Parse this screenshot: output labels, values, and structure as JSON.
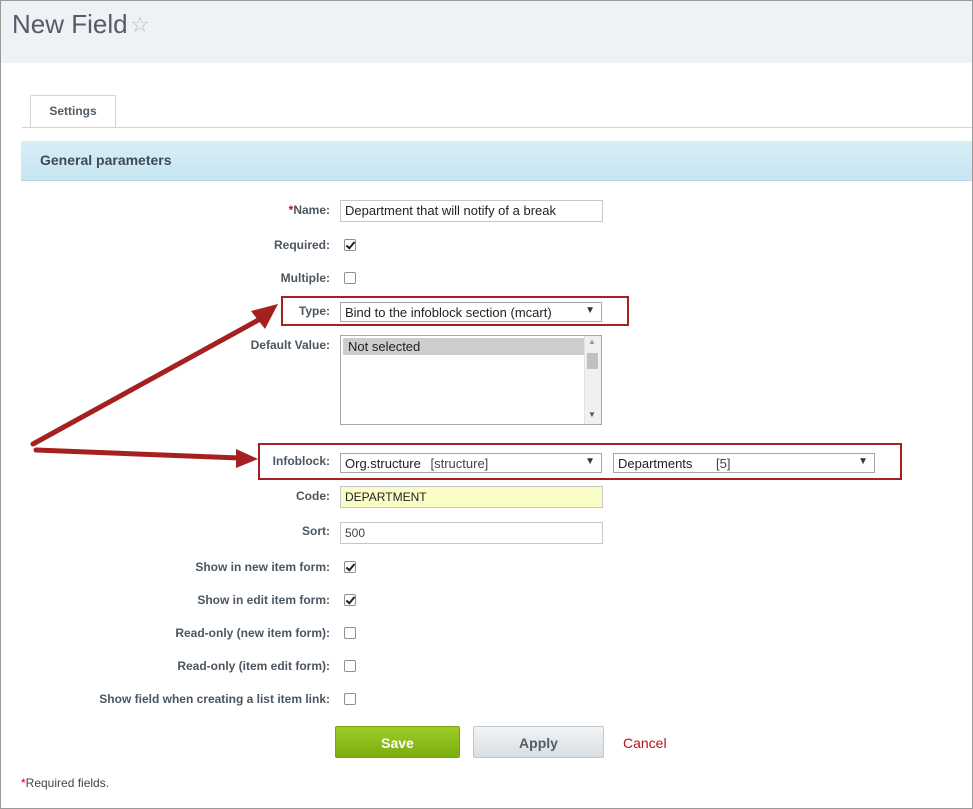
{
  "page": {
    "title": "New Field",
    "star_icon": "star-outline-icon"
  },
  "tabs": [
    {
      "label": "Settings"
    }
  ],
  "section": {
    "title": "General parameters"
  },
  "form": {
    "name": {
      "label": "Name:",
      "required_mark": "*",
      "value": "Department that will notify of a break"
    },
    "required": {
      "label": "Required:",
      "checked": true
    },
    "multiple": {
      "label": "Multiple:",
      "checked": false
    },
    "type": {
      "label": "Type:",
      "value": "Bind to the infoblock section (mcart)"
    },
    "default_value": {
      "label": "Default Value:",
      "options": [
        "Not selected"
      ]
    },
    "infoblock": {
      "label": "Infoblock:",
      "iblock_name": "Org.structure",
      "iblock_code": "[structure]",
      "section_name": "Departments",
      "section_count": "[5]"
    },
    "code": {
      "label": "Code:",
      "value": "DEPARTMENT"
    },
    "sort": {
      "label": "Sort:",
      "value": "500"
    },
    "show_in_new": {
      "label": "Show in new item form:",
      "checked": true
    },
    "show_in_edit": {
      "label": "Show in edit item form:",
      "checked": true
    },
    "readonly_new": {
      "label": "Read-only (new item form):",
      "checked": false
    },
    "readonly_edit": {
      "label": "Read-only (item edit form):",
      "checked": false
    },
    "show_link": {
      "label": "Show field when creating a list item link:",
      "checked": false
    }
  },
  "buttons": {
    "save": "Save",
    "apply": "Apply",
    "cancel": "Cancel"
  },
  "footnote": {
    "mark": "*",
    "text": "Required fields."
  },
  "colors": {
    "annotation": "#a52020",
    "save_green": "#8bbd17",
    "cancel_red": "#b4141a"
  }
}
